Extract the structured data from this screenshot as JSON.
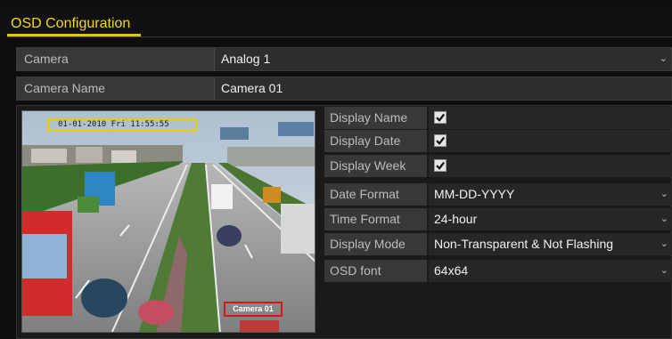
{
  "header": {
    "title": "OSD Configuration"
  },
  "camera": {
    "label": "Camera",
    "value": "Analog 1"
  },
  "camera_name": {
    "label": "Camera Name",
    "value": "Camera 01"
  },
  "preview": {
    "osd_date": "01-01-2010  Fri  11:55:55",
    "osd_name": "Camera 01"
  },
  "settings": {
    "display_name": {
      "label": "Display Name",
      "checked": true
    },
    "display_date": {
      "label": "Display Date",
      "checked": true
    },
    "display_week": {
      "label": "Display Week",
      "checked": true
    },
    "date_format": {
      "label": "Date Format",
      "value": "MM-DD-YYYY"
    },
    "time_format": {
      "label": "Time Format",
      "value": "24-hour"
    },
    "display_mode": {
      "label": "Display Mode",
      "value": "Non-Transparent & Not Flashing"
    },
    "osd_font": {
      "label": "OSD font",
      "value": "64x64"
    }
  },
  "icons": {
    "dropdown": "chevron-down-icon",
    "check": "checkmark-icon"
  },
  "colors": {
    "title": "#f4d712",
    "osd_date_box": "#e8cc00",
    "osd_name_box": "#d01818"
  }
}
